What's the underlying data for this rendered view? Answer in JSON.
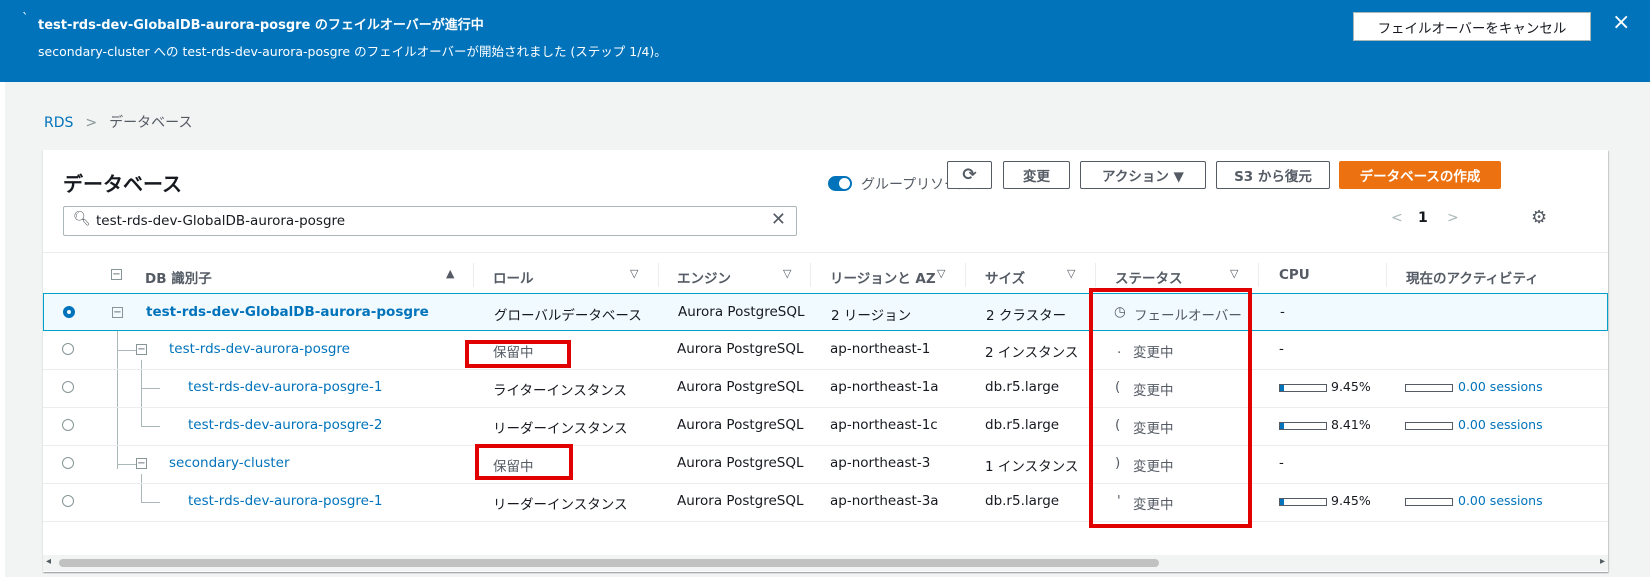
{
  "banner": {
    "title": "test-rds-dev-GlobalDB-aurora-posgre のフェイルオーバーが進行中",
    "message": "secondary-cluster への test-rds-dev-aurora-posgre のフェイルオーバーが開始されました (ステップ 1/4)。",
    "cancel_label": "フェイルオーバーをキャンセル",
    "close_icon": "×",
    "accent": "#0073bb"
  },
  "breadcrumb": {
    "root": "RDS",
    "current": "データベース"
  },
  "panel": {
    "title": "データベース",
    "group_toggle_label": "グループリソース",
    "refresh_icon": "⟳",
    "buttons": {
      "modify": "変更",
      "actions": "アクション ▼",
      "restore": "S3 から復元",
      "create": "データベースの作成"
    },
    "search_value": "test-rds-dev-GlobalDB-aurora-posgre",
    "page": "1",
    "primary_color": "#ec7211"
  },
  "columns": [
    "DB 識別子",
    "ロール",
    "エンジン",
    "リージョンと AZ",
    "サイズ",
    "ステータス",
    "CPU",
    "現在のアクティビティ"
  ],
  "rows": [
    {
      "id": "test-rds-dev-GlobalDB-aurora-posgre",
      "role": "グローバルデータベース",
      "engine": "Aurora PostgreSQL",
      "region": "2 リージョン",
      "size": "2 クラスター",
      "status": "フェールオーバー",
      "cpu": "-",
      "activity": ""
    },
    {
      "id": "test-rds-dev-aurora-posgre",
      "role": "保留中",
      "engine": "Aurora PostgreSQL",
      "region": "ap-northeast-1",
      "size": "2 インスタンス",
      "status": "変更中",
      "cpu": "-",
      "activity": ""
    },
    {
      "id": "test-rds-dev-aurora-posgre-1",
      "role": "ライターインスタンス",
      "engine": "Aurora PostgreSQL",
      "region": "ap-northeast-1a",
      "size": "db.r5.large",
      "status": "変更中",
      "cpu": "9.45%",
      "cpu_fraction": 0.0945,
      "activity": "0.00 sessions"
    },
    {
      "id": "test-rds-dev-aurora-posgre-2",
      "role": "リーダーインスタンス",
      "engine": "Aurora PostgreSQL",
      "region": "ap-northeast-1c",
      "size": "db.r5.large",
      "status": "変更中",
      "cpu": "8.41%",
      "cpu_fraction": 0.0841,
      "activity": "0.00 sessions"
    },
    {
      "id": "secondary-cluster",
      "role": "保留中",
      "engine": "Aurora PostgreSQL",
      "region": "ap-northeast-3",
      "size": "1 インスタンス",
      "status": "変更中",
      "cpu": "-",
      "activity": ""
    },
    {
      "id": "test-rds-dev-aurora-posgre-1",
      "role": "リーダーインスタンス",
      "engine": "Aurora PostgreSQL",
      "region": "ap-northeast-3a",
      "size": "db.r5.large",
      "status": "変更中",
      "cpu": "9.45%",
      "cpu_fraction": 0.0945,
      "activity": "0.00 sessions"
    }
  ]
}
